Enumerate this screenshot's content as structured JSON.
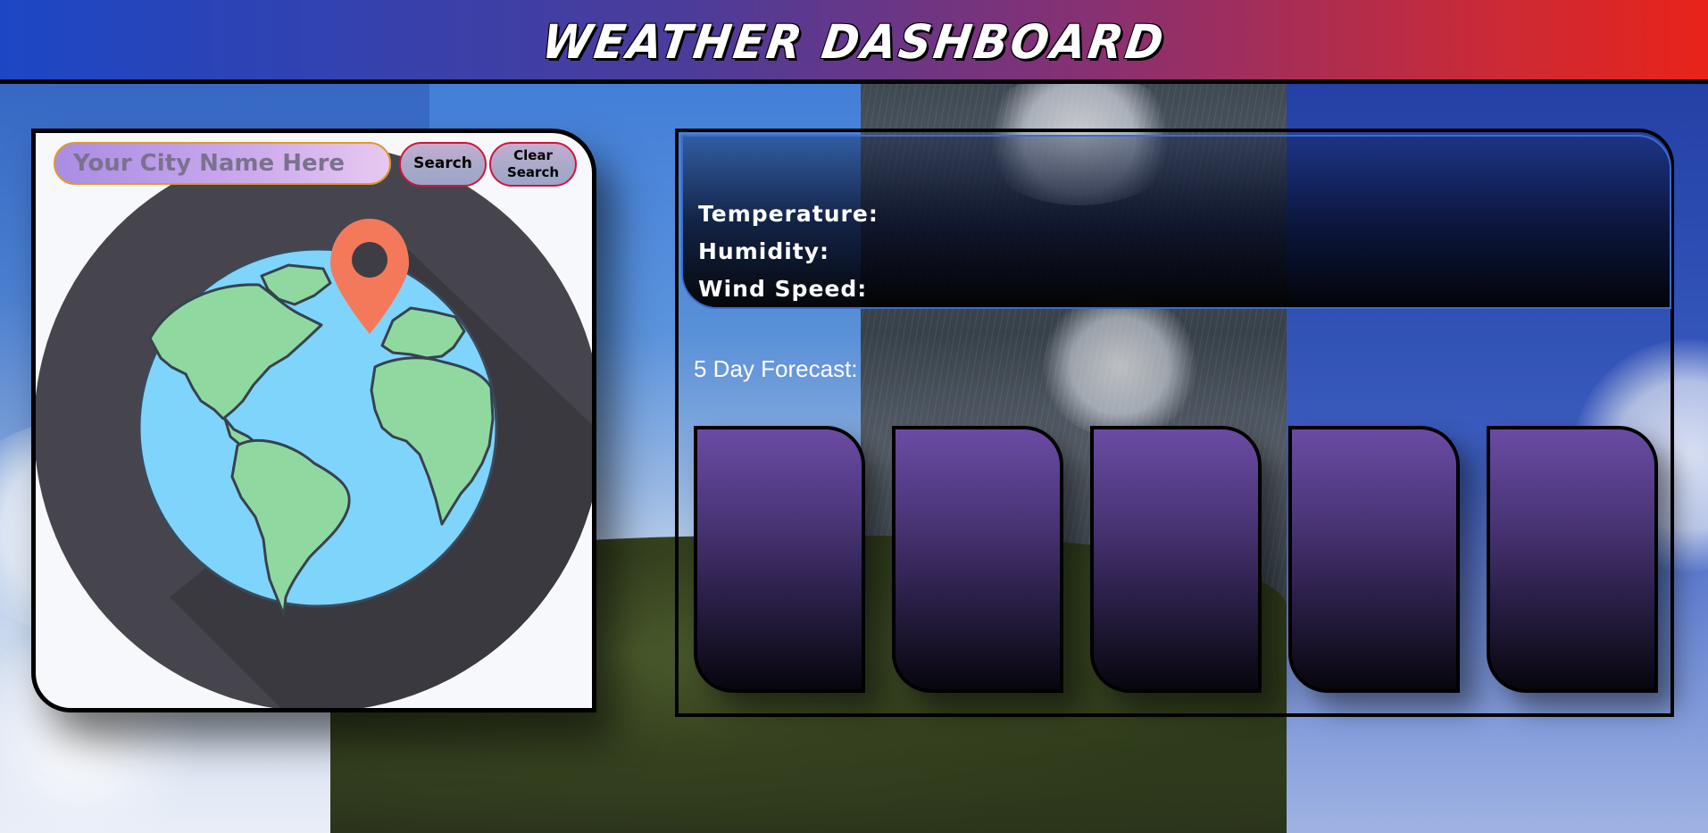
{
  "header": {
    "title": "WEATHER DASHBOARD"
  },
  "search": {
    "placeholder": "Your City Name Here",
    "value": "",
    "search_label": "Search",
    "clear_label": "Clear Search"
  },
  "current": {
    "temperature_label": "Temperature:",
    "humidity_label": "Humidity:",
    "wind_label": "Wind Speed:"
  },
  "forecast": {
    "title": "5 Day Forecast:",
    "days": [
      {
        "text": ""
      },
      {
        "text": ""
      },
      {
        "text": ""
      },
      {
        "text": ""
      },
      {
        "text": ""
      }
    ]
  },
  "colors": {
    "header_gradient_start": "#1c47c4",
    "header_gradient_end": "#e8231a",
    "card_border": "#000000",
    "button_border": "#d2143a",
    "input_border": "#e09a28",
    "day_card_top": "#6a4ba4",
    "globe_ocean": "#7fd4fb",
    "globe_land": "#8fd9a0",
    "pin": "#f4795b"
  },
  "icons": {
    "globe": "globe-location-icon"
  }
}
